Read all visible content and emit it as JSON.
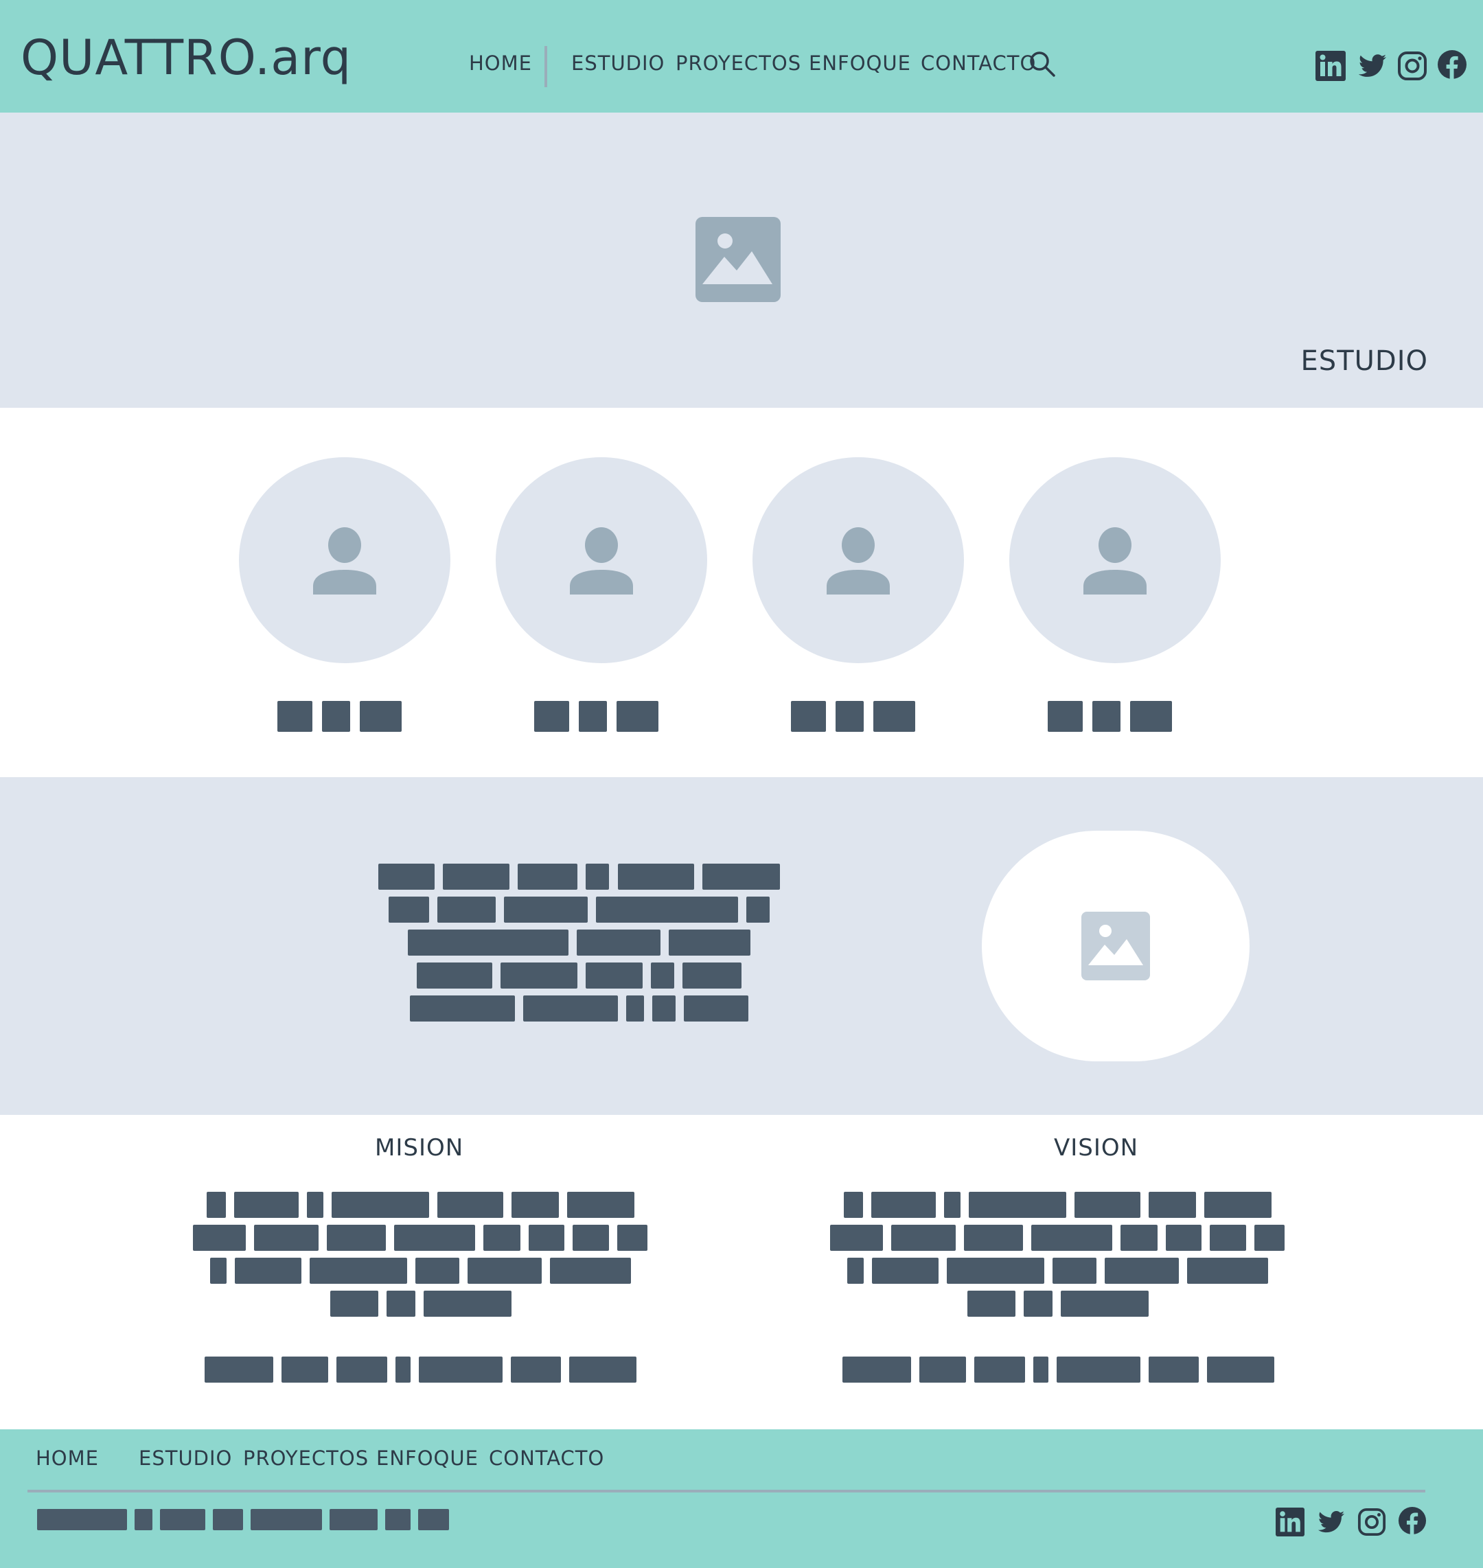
{
  "header": {
    "logo": "QUATTRO.arq",
    "nav": [
      "HOME",
      "ESTUDIO",
      "PROYECTOS",
      "ENFOQUE",
      "CONTACTO"
    ],
    "search_icon": "search-icon",
    "social": [
      "linkedin-icon",
      "twitter-icon",
      "instagram-icon",
      "facebook-icon"
    ]
  },
  "hero": {
    "image_icon": "image-placeholder-icon",
    "title": "ESTUDIO"
  },
  "team": {
    "avatar_icon": "user-placeholder-icon",
    "members": 4
  },
  "mission": {
    "title": "MISION"
  },
  "vision": {
    "title": "VISION"
  },
  "footer": {
    "nav": [
      "HOME",
      "ESTUDIO",
      "PROYECTOS",
      "ENFOQUE",
      "CONTACTO"
    ],
    "social": [
      "linkedin-icon",
      "twitter-icon",
      "instagram-icon",
      "facebook-icon"
    ]
  },
  "colors": {
    "header_bg": "#8ed7ce",
    "placeholder_bg": "#dfe5ee",
    "text_dark": "#2d3b48",
    "bar": "#4a5a69",
    "icon_grey": "#9aadba"
  }
}
